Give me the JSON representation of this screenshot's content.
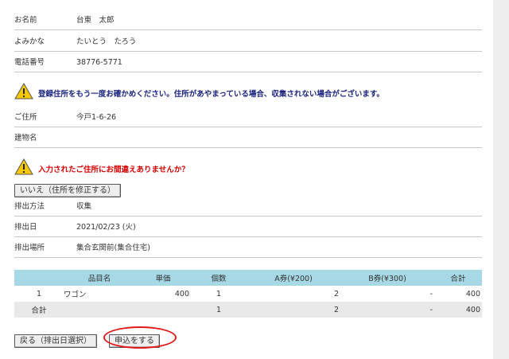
{
  "personal": [
    {
      "label": "お名前",
      "value": "台東　太郎"
    },
    {
      "label": "よみかな",
      "value": "たいとう　たろう"
    },
    {
      "label": "電話番号",
      "value": "38776-5771"
    }
  ],
  "warning_address": "登録住所をもう一度お確かめください。住所があやまっている場合、収集されない場合がございます。",
  "address": [
    {
      "label": "ご住所",
      "value": "今戸1-6-26"
    },
    {
      "label": "建物名",
      "value": ""
    }
  ],
  "warning_confirm": "入力されたご住所にお間違えありませんか？",
  "fix_address_button": "いいえ（住所を修正する）",
  "schedule": [
    {
      "label": "排出方法",
      "value": "収集"
    },
    {
      "label": "排出日",
      "value": "2021/02/23 (火)"
    },
    {
      "label": "排出場所",
      "value": "集合玄関前(集合住宅)"
    }
  ],
  "table": {
    "headers": [
      "",
      "品目名",
      "単価",
      "個数",
      "A券(¥200)",
      "B券(¥300)",
      "合計"
    ],
    "rows": [
      [
        "1",
        "ワゴン",
        "400",
        "1",
        "2",
        "-",
        "400"
      ]
    ],
    "total": [
      "合計",
      "",
      "",
      "1",
      "2",
      "-",
      "400"
    ]
  },
  "back_button": "戻る（排出日選択）",
  "submit_button": "申込をする",
  "colors": {
    "warning_blue": "#1a237e",
    "warning_red": "#d50000",
    "table_header": "#a7d8e5",
    "highlight": "#e01818"
  }
}
